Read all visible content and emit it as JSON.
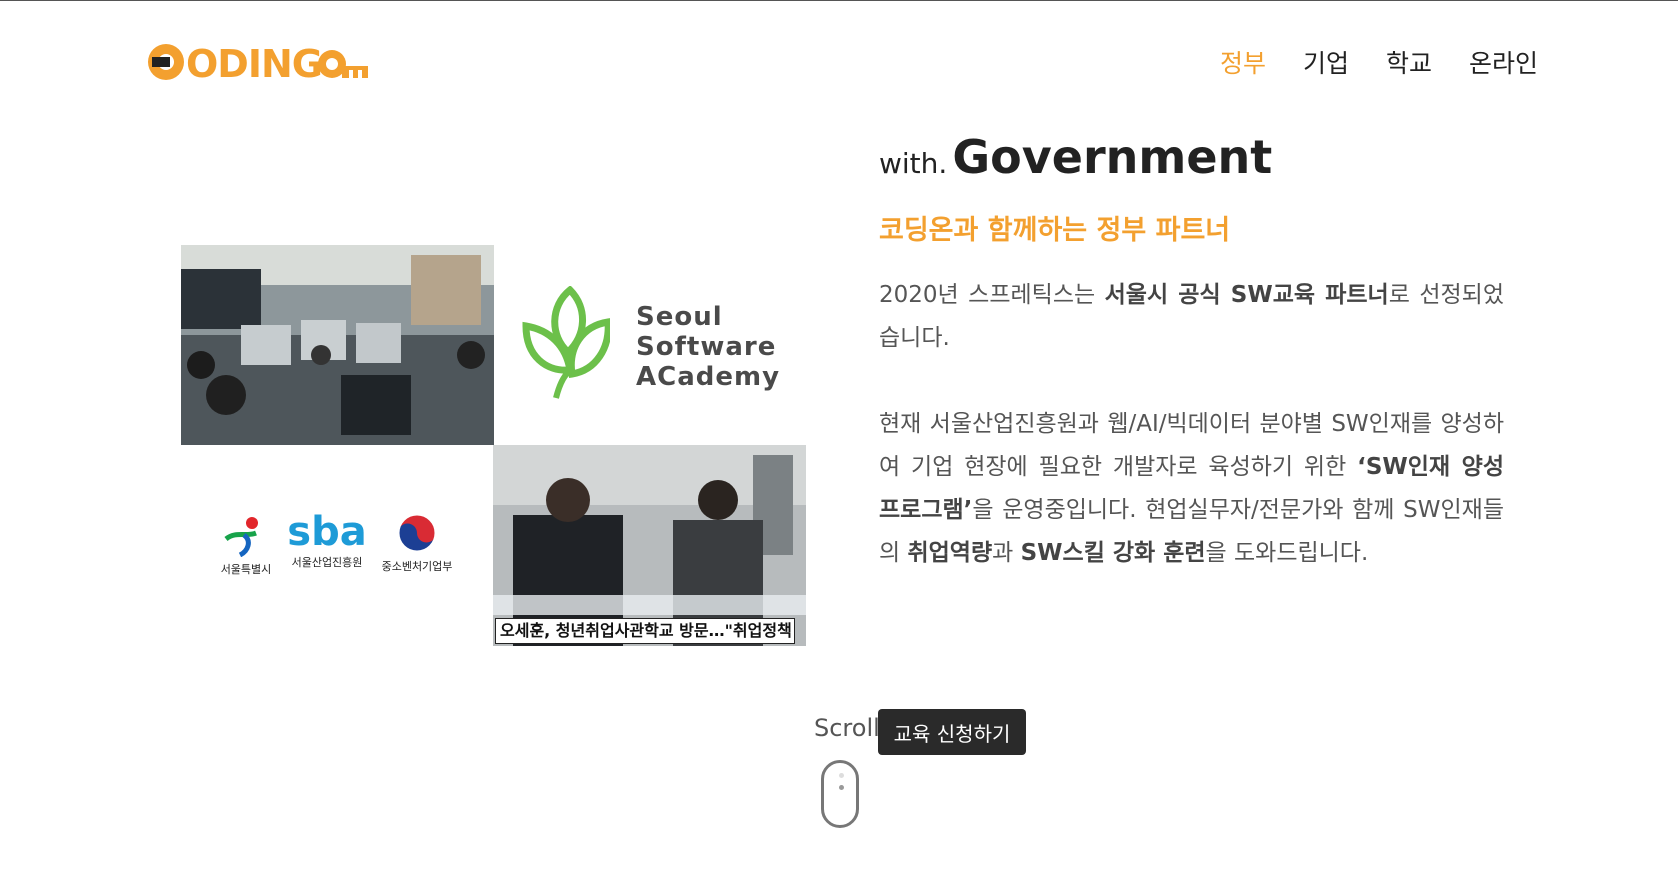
{
  "logo": {
    "text": "CODINGOn"
  },
  "nav": {
    "items": [
      {
        "label": "정부",
        "active": true
      },
      {
        "label": "기업",
        "active": false
      },
      {
        "label": "학교",
        "active": false
      },
      {
        "label": "온라인",
        "active": false
      }
    ]
  },
  "headline": {
    "prefix": "with.",
    "title": "Government"
  },
  "subheadline": "코딩온과 함께하는 정부 파트너",
  "paragraph1": {
    "t1": "2020년 스프레틱스는 ",
    "b1": "서울시 공식 SW교육 파트너",
    "t2": "로 선정되었습니다."
  },
  "paragraph2": {
    "t1": "현재 서울산업진흥원과 웹/AI/빅데이터 분야별 SW인재를 양성하여 기업 현장에 필요한 개발자로 육성하기 위한 ",
    "b1": "‘SW인재 양성 프로그램’",
    "t2": "을 운영중입니다. 현업실무자/전문가와 함께 SW인재들의 ",
    "b2": "취업역량",
    "t3": "과 ",
    "b3": "SW스킬 강화 훈련",
    "t4": "을 도와드립니다."
  },
  "ssa": {
    "line1": "Seoul",
    "line2": "Software",
    "line3": "ACademy"
  },
  "partners": [
    {
      "label": "서울특별시"
    },
    {
      "label": "서울산업진흥원",
      "mark": "sba"
    },
    {
      "label": "중소벤처기업부"
    }
  ],
  "news_caption": "오세훈, 청년취업사관학교 방문…\"취업정책 강화\"",
  "scroll_label": "Scroll",
  "apply_button": "교육 신청하기",
  "colors": {
    "accent": "#f3a02f",
    "button_bg": "#2a2a2a",
    "ssa_green": "#6cc04a"
  }
}
